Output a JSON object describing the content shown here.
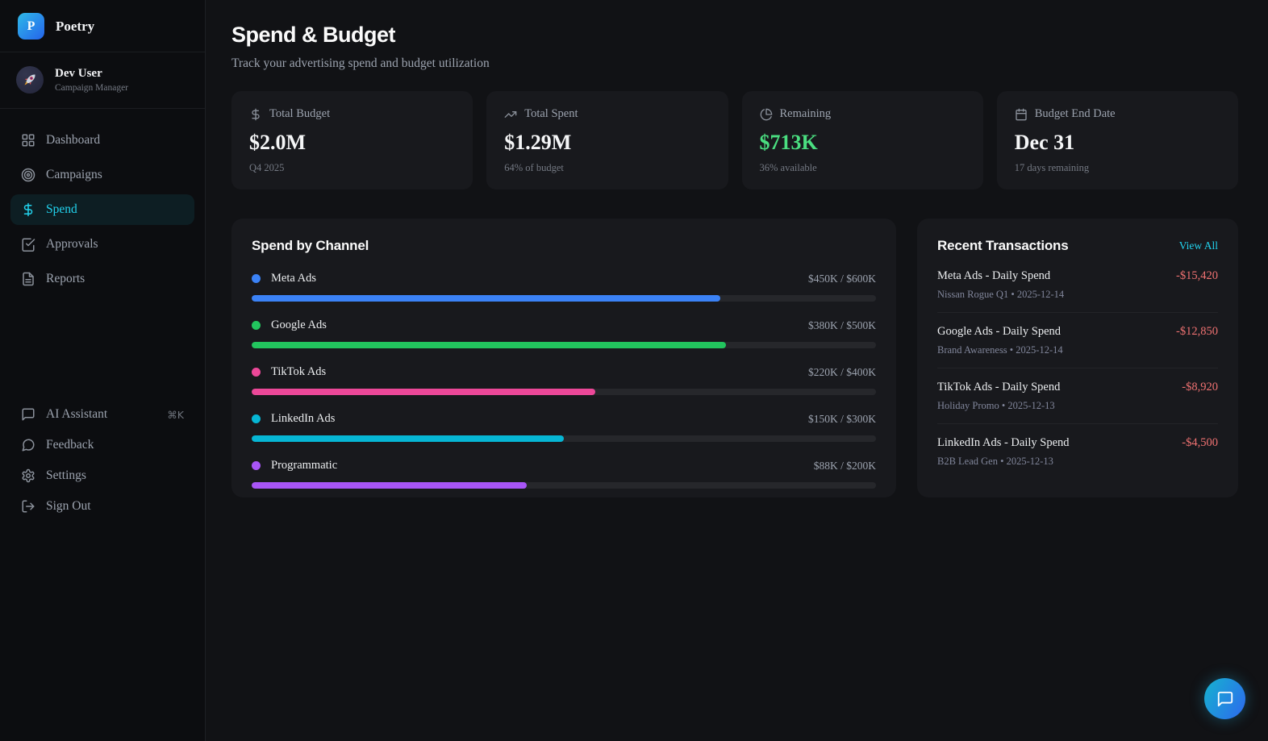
{
  "app": {
    "logo_letter": "P",
    "name": "Poetry"
  },
  "user": {
    "name": "Dev User",
    "role": "Campaign Manager"
  },
  "nav": {
    "items": [
      {
        "label": "Dashboard",
        "icon": "layout-grid-icon"
      },
      {
        "label": "Campaigns",
        "icon": "target-icon"
      },
      {
        "label": "Spend",
        "icon": "dollar-sign-icon",
        "active": true
      },
      {
        "label": "Approvals",
        "icon": "check-square-icon"
      },
      {
        "label": "Reports",
        "icon": "file-text-icon"
      }
    ],
    "bottom": [
      {
        "label": "AI Assistant",
        "icon": "message-square-icon",
        "shortcut": "⌘K"
      },
      {
        "label": "Feedback",
        "icon": "message-circle-icon"
      },
      {
        "label": "Settings",
        "icon": "gear-icon"
      },
      {
        "label": "Sign Out",
        "icon": "log-out-icon"
      }
    ]
  },
  "header": {
    "title": "Spend & Budget",
    "subtitle": "Track your advertising spend and budget utilization"
  },
  "stats": [
    {
      "label": "Total Budget",
      "value": "$2.0M",
      "sub": "Q4 2025",
      "icon": "dollar-sign-icon",
      "value_color": "#f5f6f7"
    },
    {
      "label": "Total Spent",
      "value": "$1.29M",
      "sub": "64% of budget",
      "icon": "trending-up-icon",
      "value_color": "#f5f6f7"
    },
    {
      "label": "Remaining",
      "value": "$713K",
      "sub": "36% available",
      "icon": "pie-chart-icon",
      "value_color": "#4ade80"
    },
    {
      "label": "Budget End Date",
      "value": "Dec 31",
      "sub": "17 days remaining",
      "icon": "calendar-icon",
      "value_color": "#f5f6f7"
    }
  ],
  "spend_by_channel": {
    "title": "Spend by Channel",
    "channels": [
      {
        "name": "Meta Ads",
        "amounts": "$450K / $600K",
        "spent_k": 450,
        "budget_k": 600,
        "percent": 75,
        "color": "#3b82f6"
      },
      {
        "name": "Google Ads",
        "amounts": "$380K / $500K",
        "spent_k": 380,
        "budget_k": 500,
        "percent": 76,
        "color": "#22c55e"
      },
      {
        "name": "TikTok Ads",
        "amounts": "$220K / $400K",
        "spent_k": 220,
        "budget_k": 400,
        "percent": 55,
        "color": "#ec4899"
      },
      {
        "name": "LinkedIn Ads",
        "amounts": "$150K / $300K",
        "spent_k": 150,
        "budget_k": 300,
        "percent": 50,
        "color": "#06b6d4"
      },
      {
        "name": "Programmatic",
        "amounts": "$88K / $200K",
        "spent_k": 88,
        "budget_k": 200,
        "percent": 44,
        "color": "#a855f7"
      }
    ]
  },
  "transactions": {
    "title": "Recent Transactions",
    "view_all": "View All",
    "amount_color": "#f17272",
    "items": [
      {
        "title": "Meta Ads - Daily Spend",
        "amount": "-$15,420",
        "meta": "Nissan Rogue Q1 • 2025-12-14"
      },
      {
        "title": "Google Ads - Daily Spend",
        "amount": "-$12,850",
        "meta": "Brand Awareness • 2025-12-14"
      },
      {
        "title": "TikTok Ads - Daily Spend",
        "amount": "-$8,920",
        "meta": "Holiday Promo • 2025-12-13"
      },
      {
        "title": "LinkedIn Ads - Daily Spend",
        "amount": "-$4,500",
        "meta": "B2B Lead Gen • 2025-12-13"
      }
    ]
  },
  "colors": {
    "accent_cyan": "#22d3ee",
    "positive_green": "#4ade80",
    "negative_red": "#f17272",
    "brand_gradient_start": "#2fb9e8",
    "brand_gradient_end": "#2563eb"
  }
}
